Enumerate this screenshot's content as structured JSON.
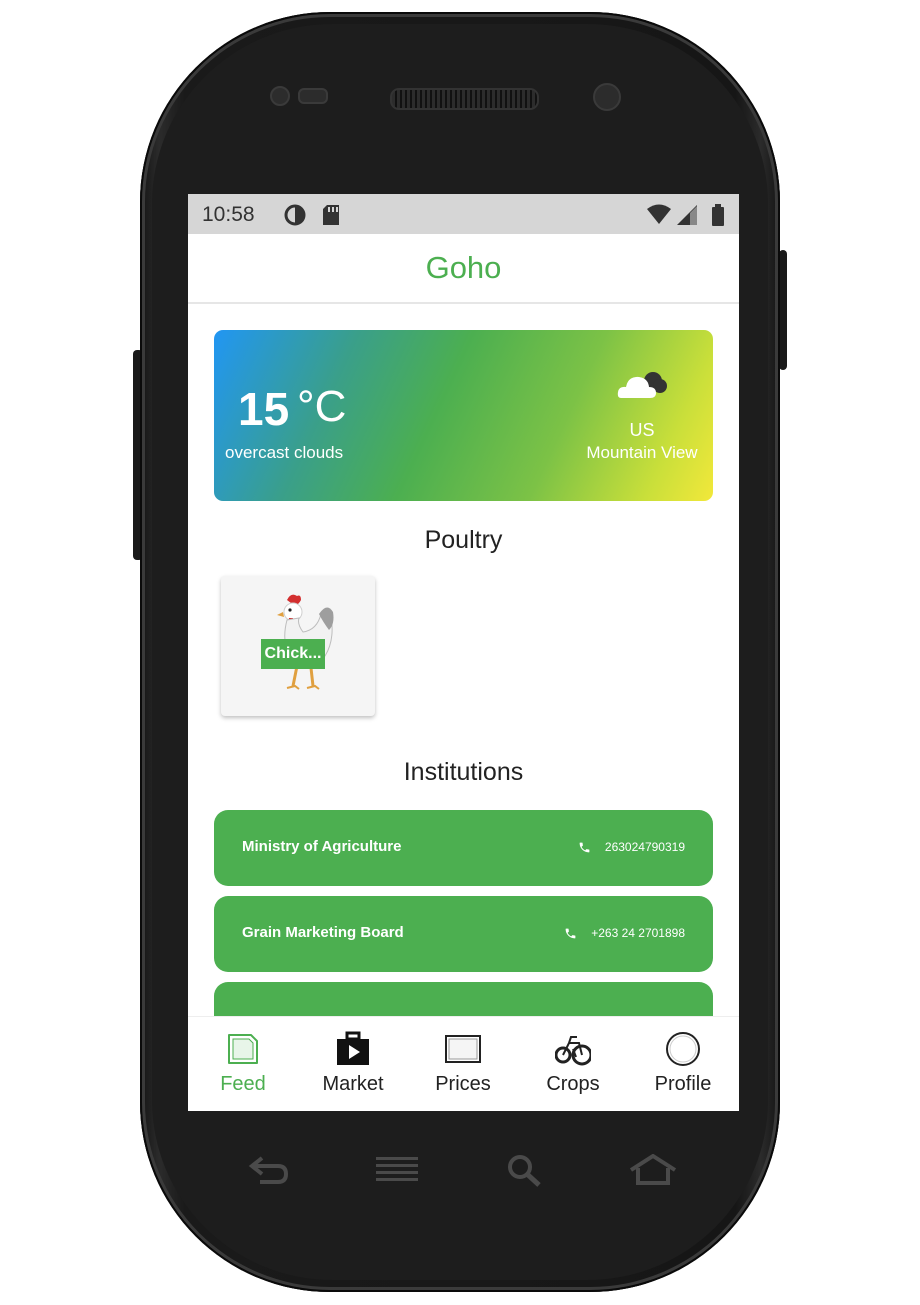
{
  "status_bar": {
    "time": "10:58",
    "icons": [
      "sync-icon",
      "sd-card-icon",
      "wifi-icon",
      "signal-icon",
      "battery-icon"
    ]
  },
  "app_bar": {
    "title": "Goho"
  },
  "weather": {
    "temperature": "15",
    "unit": "°C",
    "condition": "overcast clouds",
    "country": "US",
    "city": "Mountain View",
    "icon": "cloud-icon"
  },
  "poultry": {
    "title": "Poultry",
    "items": [
      {
        "label": "Chick..."
      }
    ]
  },
  "institutions": {
    "title": "Institutions",
    "items": [
      {
        "name": "Ministry of Agriculture",
        "phone": "263024790319"
      },
      {
        "name": "Grain Marketing Board",
        "phone": "+263 24 2701898"
      },
      {
        "name": "",
        "phone": ""
      }
    ]
  },
  "bottom_nav": {
    "items": [
      {
        "label": "Feed",
        "icon": "feed-icon",
        "active": true
      },
      {
        "label": "Market",
        "icon": "market-icon",
        "active": false
      },
      {
        "label": "Prices",
        "icon": "prices-icon",
        "active": false
      },
      {
        "label": "Crops",
        "icon": "crops-icon",
        "active": false
      },
      {
        "label": "Profile",
        "icon": "profile-icon",
        "active": false
      }
    ]
  },
  "colors": {
    "accent": "#4caf50",
    "status_bar": "#d6d6d6",
    "weather_gradient_start": "#2196f3",
    "weather_gradient_end": "#f2e83a"
  }
}
